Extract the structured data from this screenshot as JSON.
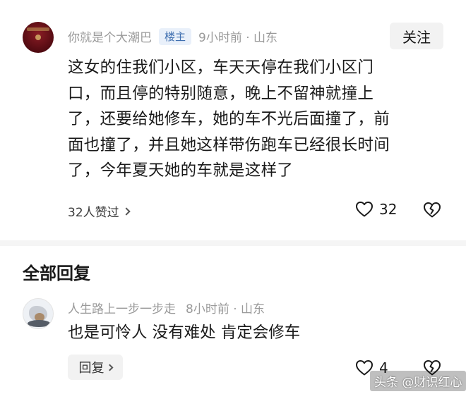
{
  "comment": {
    "username": "你就是个大潮巴",
    "badge": "楼主",
    "time_location": "9小时前 · 山东",
    "follow_label": "关注",
    "lines": [
      "这女的住我们小区，车天天停在我们小区门",
      "口，而且停的特别随意，晚上不留神就撞上",
      "了，还要给她修车，她的车不光后面撞了，前",
      "面也撞了，并且她这样带伤跑车已经很长时间",
      "了，今年夏天她的车就是这样了"
    ],
    "likers_text": "32人赞过",
    "like_count": "32"
  },
  "section": {
    "title": "全部回复"
  },
  "reply": {
    "username": "人生路上一步一步走",
    "time_location": "8小时前 · 山东",
    "text": "也是可怜人 没有难处 肯定会修车",
    "reply_label": "回复",
    "like_count": "4"
  },
  "watermark": "头条 @财识红心",
  "icons": {
    "like": "heart-icon",
    "dislike": "broken-heart-icon",
    "chevron": "chevron-right-icon"
  }
}
